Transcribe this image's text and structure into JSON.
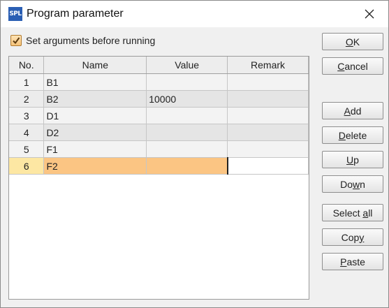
{
  "window": {
    "title": "Program parameter",
    "app_icon_text": "SPL"
  },
  "options": {
    "set_args_label": "Set arguments before running",
    "set_args_checked": true
  },
  "grid": {
    "columns": [
      "No.",
      "Name",
      "Value",
      "Remark"
    ],
    "rows": [
      {
        "no": "1",
        "name": "B1",
        "value": "",
        "remark": ""
      },
      {
        "no": "2",
        "name": "B2",
        "value": "10000",
        "remark": ""
      },
      {
        "no": "3",
        "name": "D1",
        "value": "",
        "remark": ""
      },
      {
        "no": "4",
        "name": "D2",
        "value": "",
        "remark": ""
      },
      {
        "no": "5",
        "name": "F1",
        "value": "",
        "remark": ""
      },
      {
        "no": "6",
        "name": "F2",
        "value": "",
        "remark": ""
      }
    ],
    "selected_row": 6
  },
  "buttons": {
    "ok": {
      "pre": "",
      "key": "O",
      "post": "K"
    },
    "cancel": {
      "pre": "",
      "key": "C",
      "post": "ancel"
    },
    "add": {
      "pre": "",
      "key": "A",
      "post": "dd"
    },
    "delete": {
      "pre": "",
      "key": "D",
      "post": "elete"
    },
    "up": {
      "pre": "",
      "key": "U",
      "post": "p"
    },
    "down": {
      "pre": "Do",
      "key": "w",
      "post": "n"
    },
    "select_all": {
      "pre": "Select ",
      "key": "a",
      "post": "ll"
    },
    "copy": {
      "pre": "Cop",
      "key": "y",
      "post": ""
    },
    "paste": {
      "pre": "",
      "key": "P",
      "post": "aste"
    }
  },
  "colors": {
    "selected_row": "#fbc583",
    "selected_row_number": "#fde7a3",
    "icon_blue": "#2b5fb4"
  }
}
